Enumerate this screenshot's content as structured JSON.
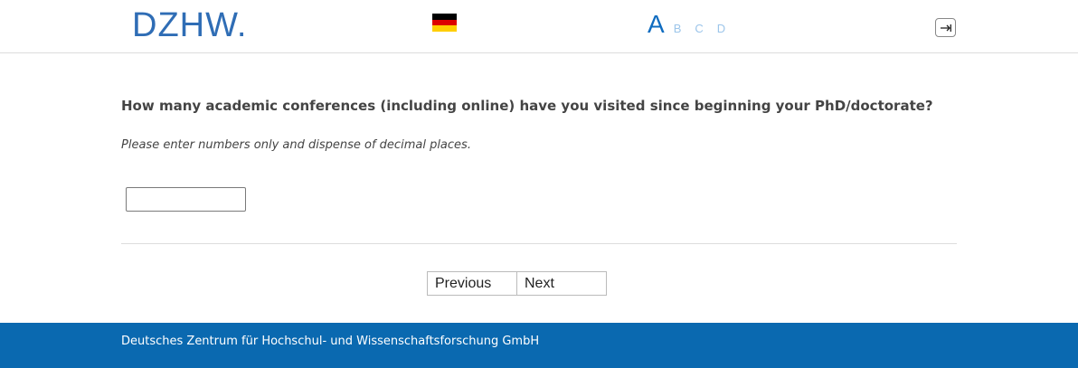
{
  "header": {
    "logo_text": "DZHW.",
    "language_flag": "de-flag-icon",
    "versions": {
      "active": "A",
      "others": [
        "B",
        "C",
        "D"
      ]
    },
    "logout_icon": "logout-icon"
  },
  "main": {
    "question": "How many academic conferences (including online) have you visited since beginning your PhD/doctorate?",
    "instruction": "Please enter numbers only and dispense of decimal places.",
    "answer_value": ""
  },
  "navigation": {
    "previous_label": "Previous",
    "next_label": "Next"
  },
  "footer": {
    "text": "Deutsches Zentrum für Hochschul- und Wissenschaftsforschung GmbH"
  },
  "colors": {
    "brand_blue": "#2f6db5",
    "footer_blue": "#0a69b0",
    "version_active": "#0f6cc0",
    "version_inactive": "#9cc5ea"
  }
}
